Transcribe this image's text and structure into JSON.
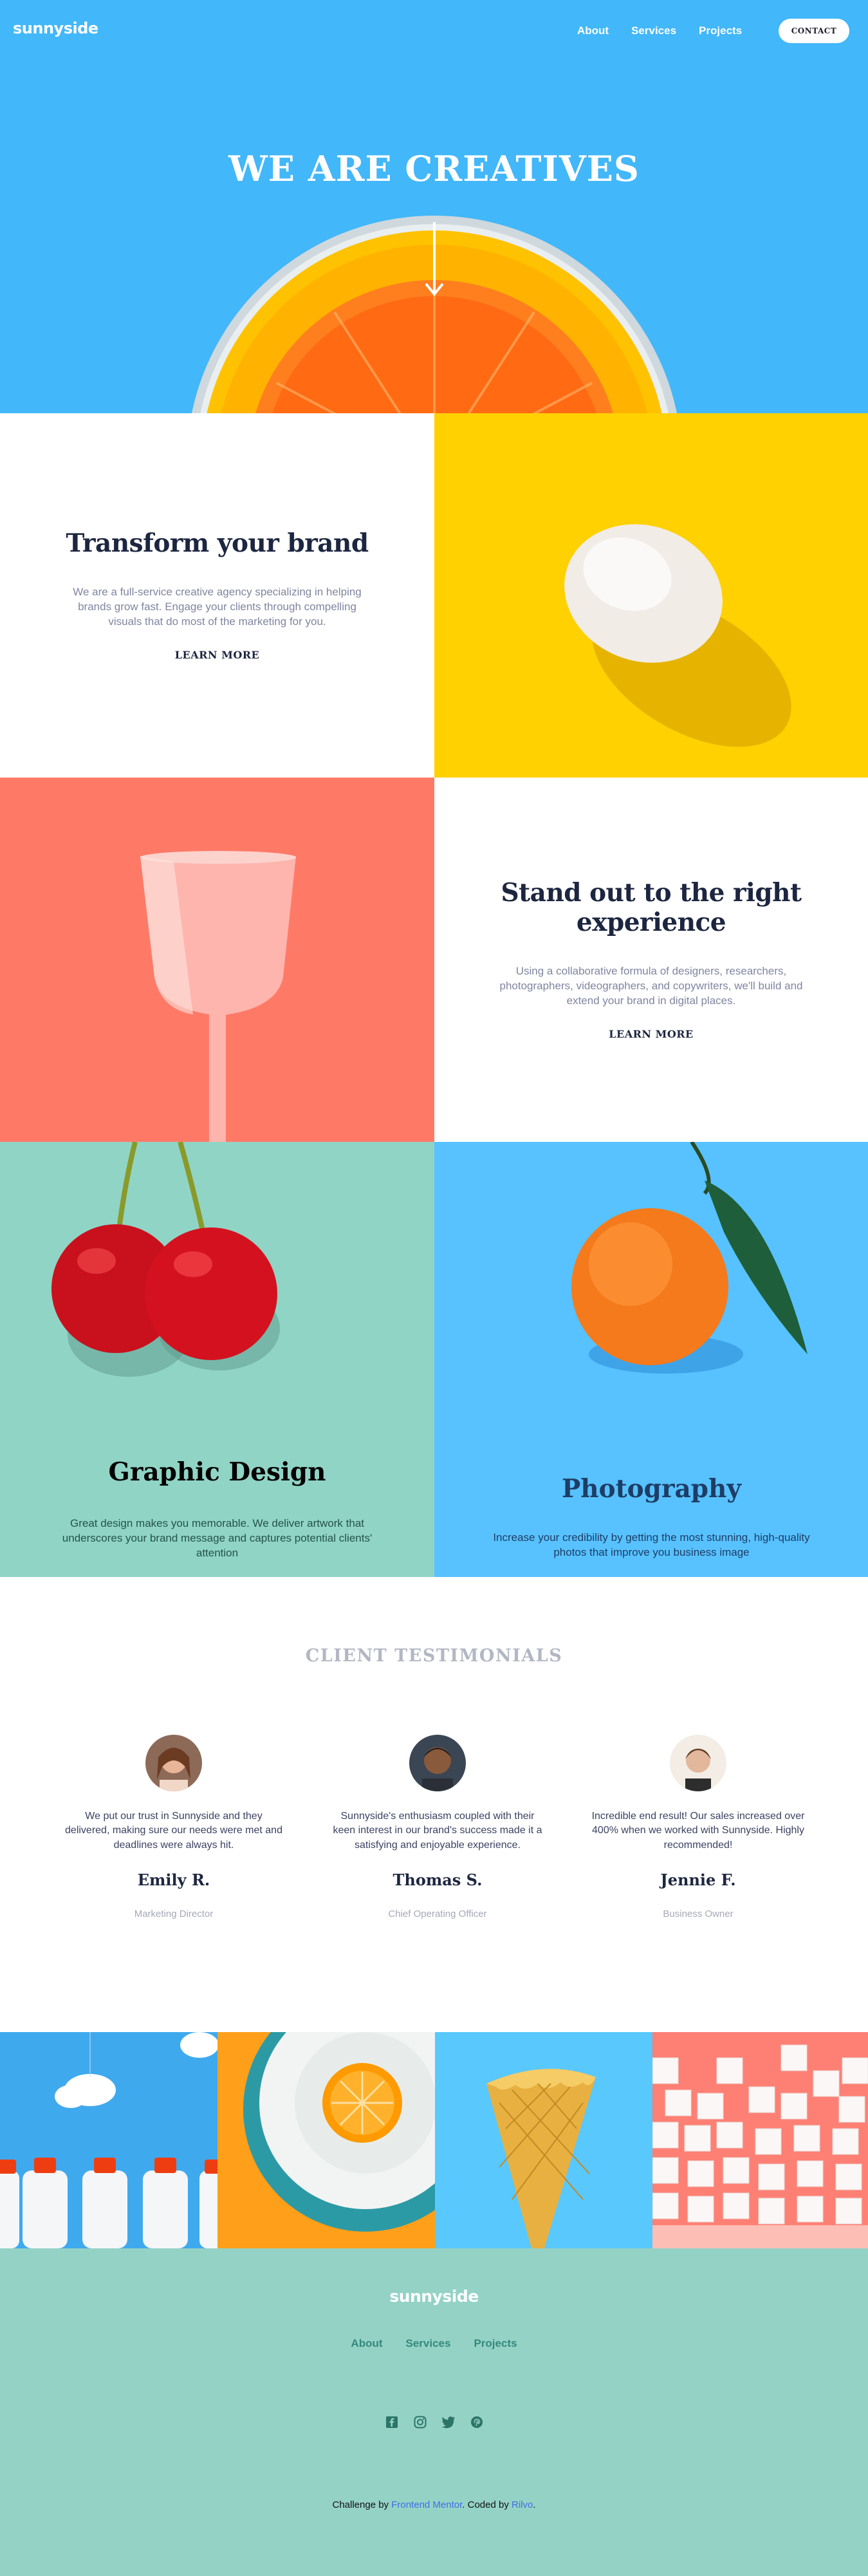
{
  "header": {
    "logo": "sunnyside",
    "nav": [
      "About",
      "Services",
      "Projects"
    ],
    "contact_label": "CONTACT"
  },
  "hero": {
    "title": "WE ARE CREATIVES",
    "arrow_icon": "arrow-down-icon"
  },
  "features": [
    {
      "title": "Transform your brand",
      "body": "We are a full-service creative agency specializing in helping brands grow fast. Engage your clients through compelling visuals that do most of the marketing for you.",
      "link": "LEARN MORE",
      "image": "egg",
      "image_bg": "#ffd100"
    },
    {
      "title": "Stand out to the right experience",
      "body": "Using a collaborative formula of designers, researchers, photographers, videographers, and copywriters, we'll build and extend your brand in digital places.",
      "link": "LEARN MORE",
      "image": "cup",
      "image_bg": "#fe7a67"
    }
  ],
  "services": [
    {
      "title": "Graphic Design",
      "body": "Great design makes you memorable. We deliver artwork that underscores your brand message and captures potential clients' attention",
      "image": "cherries",
      "bg": "#90d4c5",
      "text_color": "#24534b"
    },
    {
      "title": "Photography",
      "body": "Increase your credibility by getting the most stunning, high-quality photos that improve you business image",
      "image": "orange",
      "bg": "#57c2ff",
      "text_color": "#1e3d66"
    }
  ],
  "testimonials": {
    "heading": "CLIENT TESTIMONIALS",
    "items": [
      {
        "quote": "We put our trust in Sunnyside and they delivered, making sure our needs were met and deadlines were always hit.",
        "name": "Emily R.",
        "role": "Marketing Director"
      },
      {
        "quote": "Sunnyside's enthusiasm coupled with their keen interest in our brand's success made it a satisfying and enjoyable experience.",
        "name": "Thomas S.",
        "role": "Chief Operating Officer"
      },
      {
        "quote": "Incredible end result! Our sales increased over 400% when we worked with Sunnyside. Highly recommended!",
        "name": "Jennie F.",
        "role": "Business Owner"
      }
    ]
  },
  "gallery": [
    "milk-bottles",
    "orange-plate",
    "ice-cream-cone",
    "sugar-cubes"
  ],
  "footer": {
    "logo": "sunnyside",
    "nav": [
      "About",
      "Services",
      "Projects"
    ],
    "socials": [
      "facebook-icon",
      "instagram-icon",
      "twitter-icon",
      "pinterest-icon"
    ],
    "attribution_prefix": "Challenge by",
    "attribution_fm": "Frontend Mentor",
    "attribution_mid": ". Coded by",
    "attribution_author": "Rilvo",
    "attribution_end": "."
  },
  "colors": {
    "hero_bg": "#42b7f9",
    "dark_text": "#1d2640",
    "footer_bg": "#94d2c6",
    "link_blue": "#3f6ee4"
  }
}
